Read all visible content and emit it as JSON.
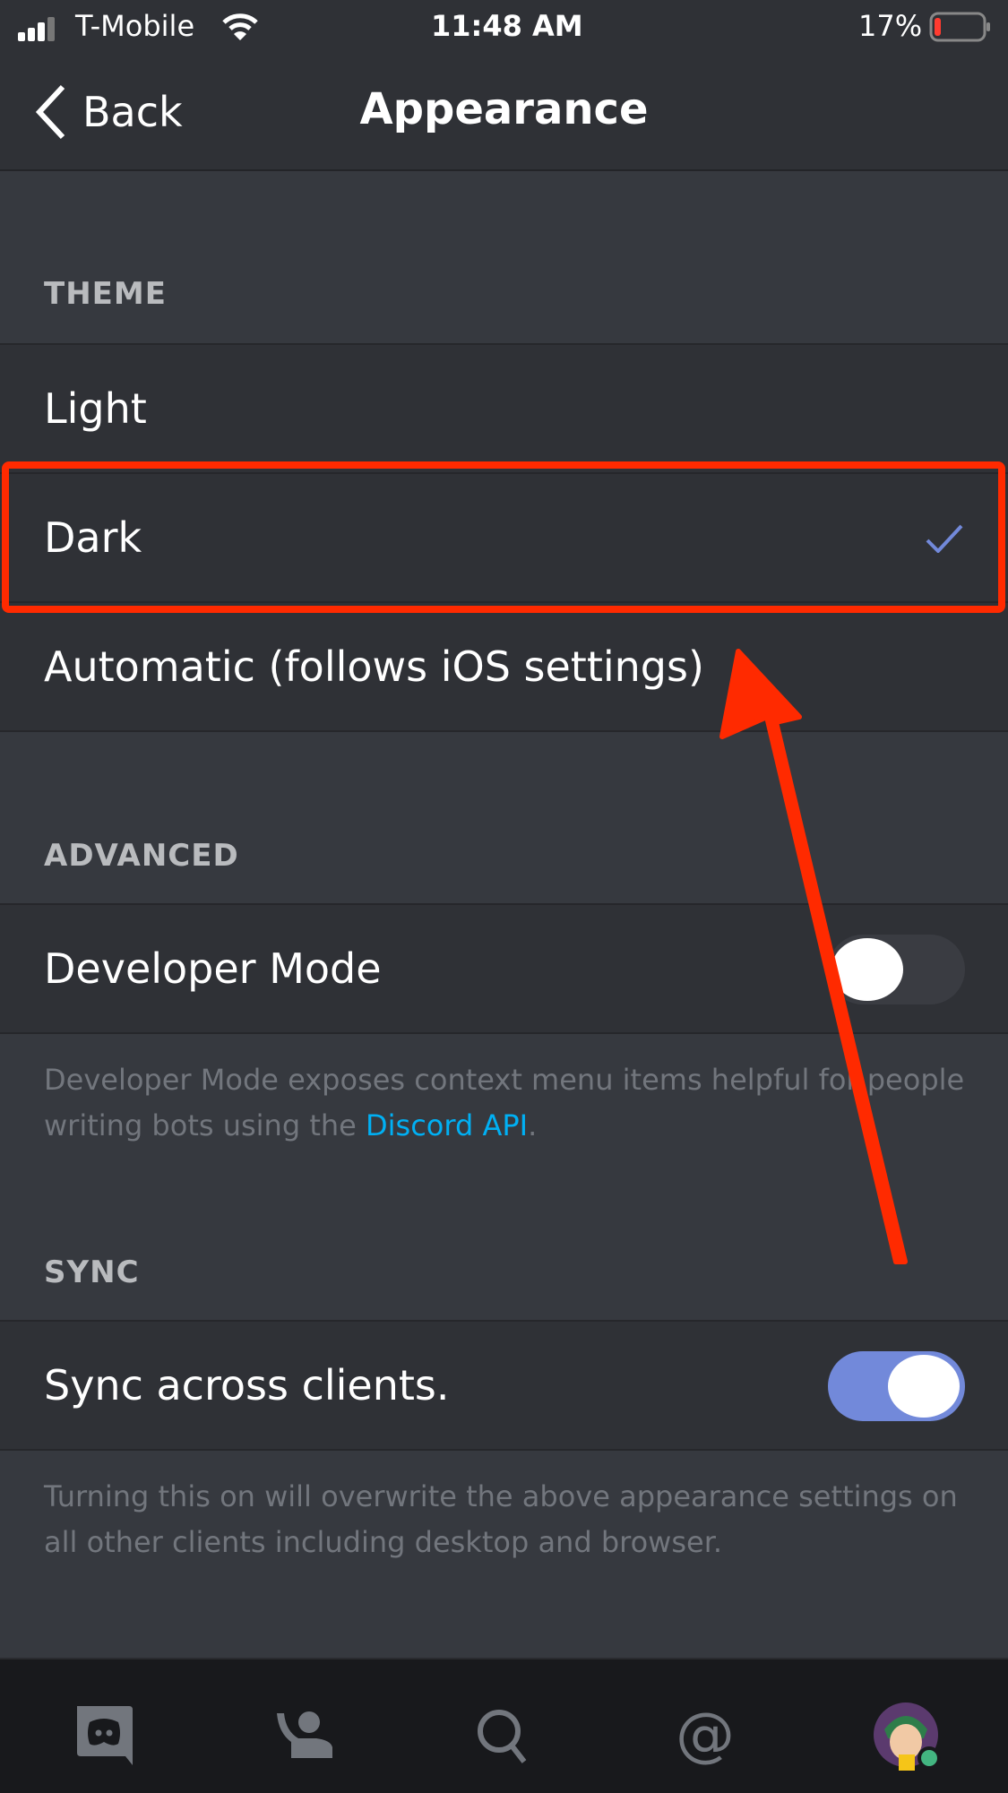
{
  "status_bar": {
    "carrier": "T-Mobile",
    "time": "11:48 AM",
    "battery": "17%",
    "battery_level": 0.17
  },
  "nav": {
    "back_label": "Back",
    "title": "Appearance"
  },
  "theme": {
    "header": "THEME",
    "options": [
      {
        "label": "Light",
        "selected": false
      },
      {
        "label": "Dark",
        "selected": true
      },
      {
        "label": "Automatic (follows iOS settings)",
        "selected": false
      }
    ]
  },
  "advanced": {
    "header": "ADVANCED",
    "developer_mode": {
      "label": "Developer Mode",
      "on": false
    },
    "desc_prefix": "Developer Mode exposes context menu items helpful for people writing bots using the ",
    "desc_link": "Discord API",
    "desc_suffix": "."
  },
  "sync": {
    "header": "SYNC",
    "label": "Sync across clients.",
    "on": true,
    "desc": "Turning this on will overwrite the above appearance settings on all other clients including desktop and browser."
  },
  "tabs": [
    "home-icon",
    "friends-icon",
    "search-icon",
    "mentions-icon",
    "profile-avatar"
  ],
  "colors": {
    "accent": "#7289da",
    "link": "#00b0f4",
    "annotation": "#ff2a00",
    "online": "#43b581"
  }
}
